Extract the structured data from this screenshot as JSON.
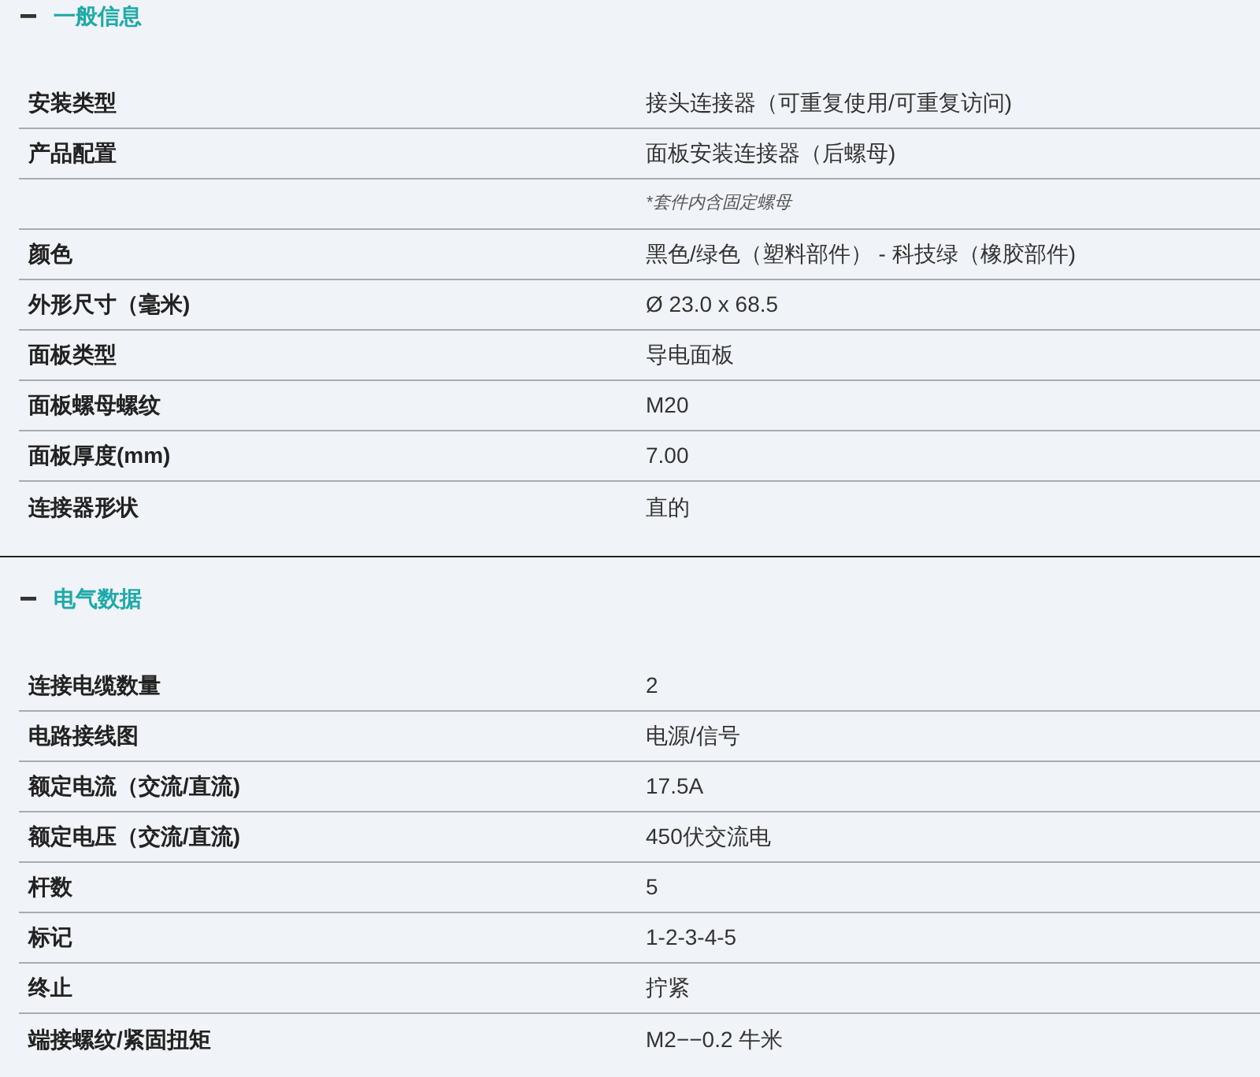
{
  "sections": [
    {
      "title": "一般信息",
      "expanded": true,
      "rows": [
        {
          "kind": "pair",
          "label": "安装类型",
          "value": "接头连接器（可重复使用/可重复访问)"
        },
        {
          "kind": "pair",
          "label": "产品配置",
          "value": "面板安装连接器（后螺母)"
        },
        {
          "kind": "note",
          "value": "*套件内含固定螺母"
        },
        {
          "kind": "pair",
          "label": "颜色",
          "value": "黑色/绿色（塑料部件） - 科技绿（橡胶部件)"
        },
        {
          "kind": "pair",
          "label": "外形尺寸（毫米)",
          "value": "Ø 23.0 x 68.5"
        },
        {
          "kind": "pair",
          "label": "面板类型",
          "value": "导电面板"
        },
        {
          "kind": "pair",
          "label": "面板螺母螺纹",
          "value": "M20"
        },
        {
          "kind": "pair",
          "label": "面板厚度(mm)",
          "value": "7.00"
        },
        {
          "kind": "pair",
          "label": "连接器形状",
          "value": "直的"
        }
      ]
    },
    {
      "title": "电气数据",
      "expanded": true,
      "rows": [
        {
          "kind": "pair",
          "label": "连接电缆数量",
          "value": "2"
        },
        {
          "kind": "pair",
          "label": "电路接线图",
          "value": "电源/信号"
        },
        {
          "kind": "pair",
          "label": "额定电流（交流/直流)",
          "value": "17.5A"
        },
        {
          "kind": "pair",
          "label": "额定电压（交流/直流)",
          "value": "450伏交流电"
        },
        {
          "kind": "pair",
          "label": "杆数",
          "value": "5"
        },
        {
          "kind": "pair",
          "label": "标记",
          "value": "1-2-3-4-5"
        },
        {
          "kind": "pair",
          "label": "终止",
          "value": "拧紧"
        },
        {
          "kind": "pair",
          "label": "端接螺纹/紧固扭矩",
          "value": "M2−−0.2 牛米"
        }
      ]
    }
  ]
}
